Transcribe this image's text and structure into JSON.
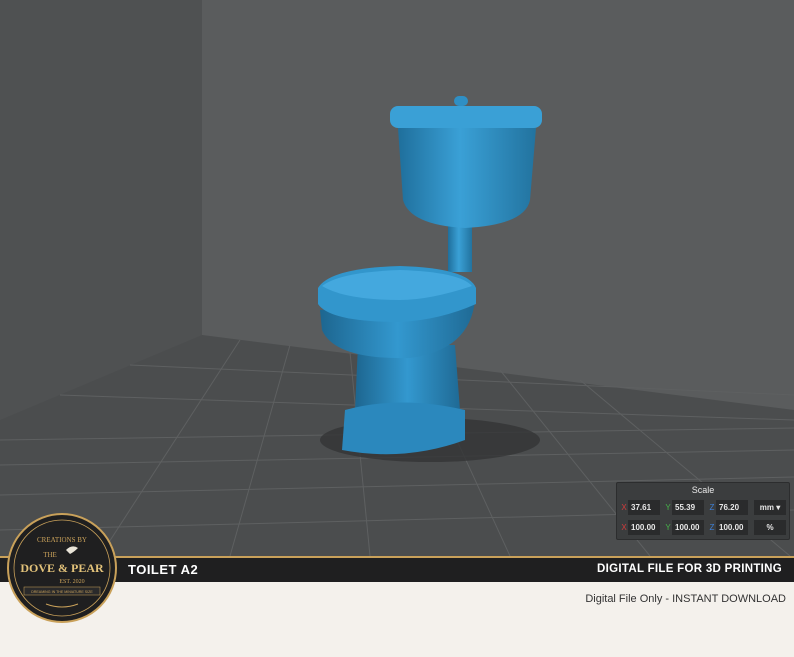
{
  "scale_panel": {
    "title": "Scale",
    "rows": [
      {
        "x": "37.61",
        "y": "55.39",
        "z": "76.20",
        "unit": "mm ▾"
      },
      {
        "x": "100.00",
        "y": "100.00",
        "z": "100.00",
        "unit": "%"
      }
    ],
    "axis_labels": {
      "x": "X",
      "y": "Y",
      "z": "Z"
    }
  },
  "product": {
    "name": "TOILET A2",
    "tagline": "DIGITAL FILE FOR 3D PRINTING",
    "subtitle": "Digital File Only - INSTANT DOWNLOAD"
  },
  "logo": {
    "top_text": "CREATIONS BY",
    "the": "THE",
    "name": "DOVE & PEAR",
    "est": "EST. 2020",
    "bottom_text": "DREAMING IN THE MINIATURE SIZE",
    "icon": "dove-icon"
  },
  "colors": {
    "model": "#2f8fc4",
    "background": "#565859",
    "title_bar": "#1f1f20",
    "accent": "#c9a15a"
  }
}
